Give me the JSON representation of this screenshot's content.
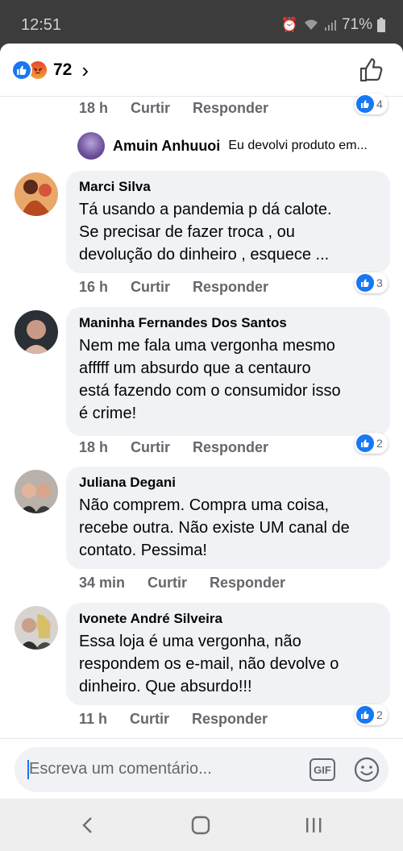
{
  "status_bar": {
    "time": "12:51",
    "battery": "71%"
  },
  "header": {
    "reaction_count": "72"
  },
  "top_reply_meta": {
    "time": "18 h",
    "like": "Curtir",
    "reply": "Responder",
    "reactions": "4"
  },
  "nested_reply": {
    "name": "Amuin Anhuuoi",
    "text": "Eu devolvi produto em..."
  },
  "comments": [
    {
      "name": "Marci Silva",
      "text": "Tá  usando  a pandemia p dá calote.\nSe precisar de fazer troca , ou\ndevolução  do  dinheiro  , esquece ...",
      "time": "16 h",
      "like": "Curtir",
      "reply": "Responder",
      "reactions": "3"
    },
    {
      "name": "Maninha Fernandes Dos Santos",
      "text": "Nem me fala uma vergonha mesmo\nafffff um absurdo que a centauro\nestá fazendo com o consumidor isso\né crime!",
      "time": "18 h",
      "like": "Curtir",
      "reply": "Responder",
      "reactions": "2"
    },
    {
      "name": "Juliana Degani",
      "text": "Não comprem. Compra uma coisa,\nrecebe outra. Não existe UM canal de\ncontato. Pessima!",
      "time": "34 min",
      "like": "Curtir",
      "reply": "Responder",
      "reactions": ""
    },
    {
      "name": "Ivonete André Silveira",
      "text": "Essa loja é uma vergonha, não\nrespondem os e-mail, não devolve o\ndinheiro. Que absurdo!!!",
      "time": "11 h",
      "like": "Curtir",
      "reply": "Responder",
      "reactions": "2"
    }
  ],
  "composer": {
    "placeholder": "Escreva um comentário...",
    "gif_label": "GIF"
  },
  "colors": {
    "accent": "#1877f2",
    "bubble": "#f0f2f5",
    "meta": "#65676b"
  }
}
